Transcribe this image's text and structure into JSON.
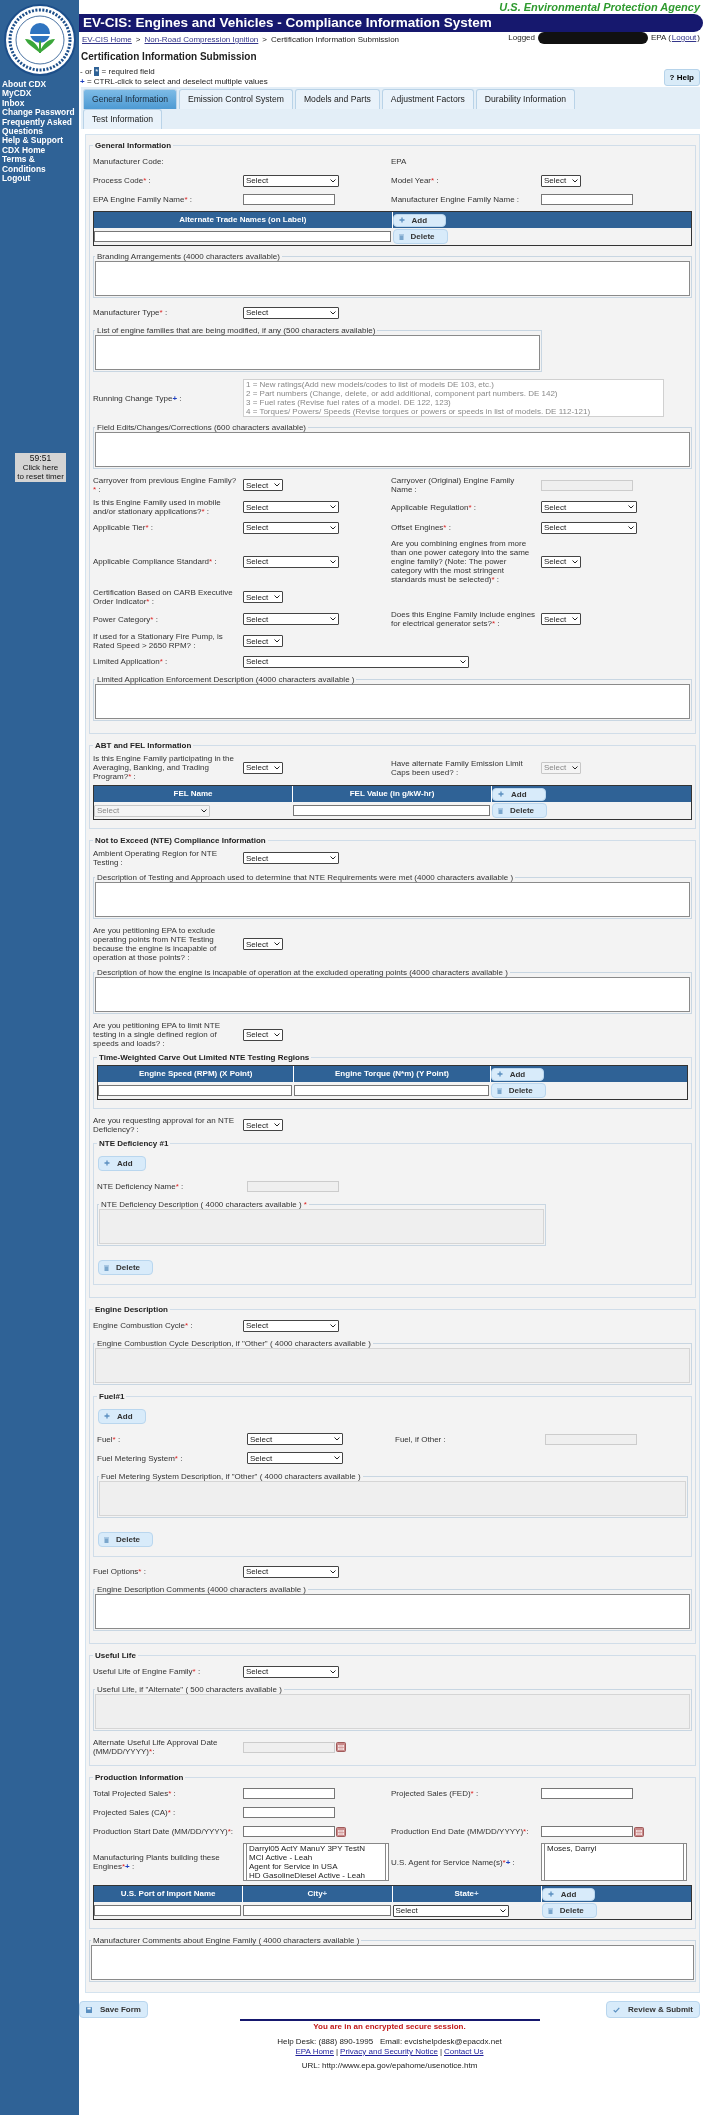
{
  "header": {
    "agency": "U.S. Environmental Protection Agency",
    "title": "EV-CIS: Engines and Vehicles - Compliance Information System",
    "login_start": "Logged",
    "login_end": "EPA (",
    "logout": "Logout",
    "login_close": ")"
  },
  "breadcrumb": [
    {
      "kind": "link",
      "text": "EV-CIS Home"
    },
    {
      "kind": "text",
      "text": ">"
    },
    {
      "kind": "link",
      "text": "Non-Road Compression Ignition"
    },
    {
      "kind": "text",
      "text": ">"
    },
    {
      "kind": "text",
      "text": "Certification Information Submission"
    }
  ],
  "sidebar": {
    "links": [
      "About CDX",
      "MyCDX",
      "Inbox",
      "Change Password",
      "Frequently Asked Questions",
      "Help & Support",
      "CDX Home",
      "Terms & Conditions",
      "Logout"
    ],
    "timer": {
      "time": "59:51",
      "lines": [
        "Click here",
        "to reset timer"
      ]
    }
  },
  "page_title": "Certification Information Submission",
  "legend": [
    {
      "kind": "required",
      "before": "- or",
      "mark": "*",
      "after": "= required field"
    },
    {
      "kind": "multi",
      "mark": "+",
      "after": "= CTRL-click to select and deselect multiple values"
    }
  ],
  "help": "? Help",
  "tabs": [
    {
      "label": "General Information",
      "selected": true
    },
    {
      "label": "Emission Control System",
      "selected": false
    },
    {
      "label": "Models and Parts",
      "selected": false
    },
    {
      "label": "Adjustment Factors",
      "selected": false
    },
    {
      "label": "Durability Information",
      "selected": false
    },
    {
      "label": "Test Information",
      "selected": false
    }
  ],
  "form": [
    {
      "kind": "fieldset",
      "title": "General Information",
      "items": [
        {
          "kind": "row",
          "cells": [
            {
              "kind": "label",
              "text": "Manufacturer Code:"
            },
            {
              "kind": "empty"
            },
            {
              "kind": "static",
              "text": "EPA"
            }
          ]
        },
        {
          "kind": "row",
          "cells": [
            {
              "kind": "label",
              "text": "Process Code",
              "star": "*",
              "colon": " :"
            },
            {
              "kind": "select",
              "value": "Select",
              "disabled": false
            },
            {
              "kind": "label",
              "text": "Model Year",
              "star": "*",
              "colon": " :"
            },
            {
              "kind": "small_select",
              "value": "Select",
              "disabled": false
            }
          ]
        },
        {
          "kind": "row",
          "cells": [
            {
              "kind": "label",
              "text": "EPA Engine Family Name",
              "star": "*",
              "colon": " :"
            },
            {
              "kind": "text",
              "disabled": false
            },
            {
              "kind": "label",
              "text": "Manufacturer Engine Family Name :"
            },
            {
              "kind": "text",
              "disabled": false
            }
          ]
        },
        {
          "kind": "table",
          "columns": [
            {
              "label": "Alternate Trade Names (on Label)"
            }
          ],
          "rows": [
            [
              {
                "kind": "text",
                "disabled": false
              }
            ]
          ],
          "add": "Add",
          "delete": "Delete"
        },
        {
          "kind": "textarea",
          "label": "Branding Arrangements",
          "count": "(4000 characters available)",
          "disabled": false
        },
        {
          "kind": "row",
          "cells": [
            {
              "kind": "label",
              "text": "Manufacturer Type",
              "star": "*",
              "colon": " :"
            },
            {
              "kind": "select",
              "value": "Select",
              "disabled": false
            }
          ]
        },
        {
          "kind": "short_textarea",
          "label": "List of engine families that are being modified, if any",
          "count": "(500 characters available)",
          "disabled": false
        },
        {
          "kind": "row",
          "cells": [
            {
              "kind": "label",
              "text": "Running Change Type",
              "plus": "+",
              "colon": " :"
            },
            {
              "kind": "wide_listbox",
              "disabled": true,
              "options": [
                "1 = New ratings(Add new models/codes to list of models DE 103, etc.)",
                "2 = Part numbers (Change, delete, or add additional, component part numbers. DE 142)",
                "3 = Fuel rates (Revise fuel rates of a model. DE 122, 123)",
                "4 = Torques/ Powers/ Speeds (Revise torques or powers or speeds in list of models. DE 112-121)"
              ]
            }
          ]
        },
        {
          "kind": "textarea",
          "label": "Field Edits/Changes/Corrections",
          "count": "(600 characters available)",
          "disabled": false
        },
        {
          "kind": "row",
          "cells": [
            {
              "kind": "label",
              "text": "Carryover from previous Engine Family?",
              "star": "*",
              "colon": " :"
            },
            {
              "kind": "small_select",
              "value": "Select",
              "disabled": false
            },
            {
              "kind": "label",
              "text": "Carryover (Original) Engine Family Name :"
            },
            {
              "kind": "text",
              "disabled": true
            }
          ]
        },
        {
          "kind": "row",
          "cells": [
            {
              "kind": "label",
              "text": "Is this Engine Family used in mobile and/or stationary applications?",
              "star": "*",
              "colon": " :"
            },
            {
              "kind": "select",
              "value": "Select",
              "disabled": false
            },
            {
              "kind": "label",
              "text": "Applicable Regulation",
              "star": "*",
              "colon": " :"
            },
            {
              "kind": "select",
              "value": "Select",
              "disabled": false
            }
          ]
        },
        {
          "kind": "row",
          "cells": [
            {
              "kind": "label",
              "text": "Applicable Tier",
              "star": "*",
              "colon": " :"
            },
            {
              "kind": "select",
              "value": "Select",
              "disabled": false
            },
            {
              "kind": "label",
              "text": "Offset Engines",
              "star": "*",
              "colon": " :"
            },
            {
              "kind": "select",
              "value": "Select",
              "disabled": false
            }
          ]
        },
        {
          "kind": "row",
          "cells": [
            {
              "kind": "label",
              "text": "Applicable Compliance Standard",
              "star": "*",
              "colon": " :"
            },
            {
              "kind": "select",
              "value": "Select",
              "disabled": false
            },
            {
              "kind": "label",
              "text": "Are you combining engines from more than one power category into the same engine family? (Note: The power category with the most stringent standards must be selected)",
              "star": "*",
              "colon": " :"
            },
            {
              "kind": "small_select",
              "value": "Select",
              "disabled": false
            }
          ]
        },
        {
          "kind": "row",
          "cells": [
            {
              "kind": "label",
              "text": "Certification Based on CARB Executive Order Indicator",
              "star": "*",
              "colon": " :"
            },
            {
              "kind": "small_select",
              "value": "Select",
              "disabled": false
            }
          ]
        },
        {
          "kind": "row",
          "cells": [
            {
              "kind": "label",
              "text": "Power Category",
              "star": "*",
              "colon": " :"
            },
            {
              "kind": "select",
              "value": "Select",
              "disabled": false
            },
            {
              "kind": "label",
              "text": "Does this Engine Family include engines for electrical generator sets?",
              "star": "*",
              "colon": " :"
            },
            {
              "kind": "small_select",
              "value": "Select",
              "disabled": false
            }
          ]
        },
        {
          "kind": "row",
          "cells": [
            {
              "kind": "label",
              "text": "If used for a Stationary Fire Pump, is Rated Speed > 2650 RPM? :"
            },
            {
              "kind": "small_select",
              "value": "Select",
              "disabled": false
            }
          ]
        },
        {
          "kind": "row",
          "cells": [
            {
              "kind": "label",
              "text": "Limited Application",
              "star": "*",
              "colon": " :"
            },
            {
              "kind": "wide_select",
              "value": "Select",
              "disabled": false
            }
          ]
        },
        {
          "kind": "textarea",
          "label": "Limited Application Enforcement Description",
          "count": "(4000 characters available )",
          "disabled": false
        }
      ]
    },
    {
      "kind": "fieldset",
      "title": "ABT and FEL Information",
      "items": [
        {
          "kind": "row",
          "cells": [
            {
              "kind": "label",
              "text": "Is this Engine Family participating in the Averaging, Banking, and Trading Program?",
              "star": "*",
              "colon": " :"
            },
            {
              "kind": "small_select",
              "value": "Select",
              "disabled": false
            },
            {
              "kind": "label",
              "text": "Have alternate Family Emission Limit Caps been used? :"
            },
            {
              "kind": "small_select",
              "value": "Select",
              "disabled": true
            }
          ]
        },
        {
          "kind": "table",
          "columns": [
            {
              "label": "FEL Name"
            },
            {
              "label": "FEL Value (in g/kW-hr)"
            }
          ],
          "rows": [
            [
              {
                "kind": "select",
                "value": "Select",
                "disabled": true
              },
              {
                "kind": "text",
                "disabled": false
              }
            ]
          ],
          "add": "Add",
          "delete": "Delete"
        }
      ]
    },
    {
      "kind": "fieldset",
      "title": "Not to Exceed (NTE) Compliance Information",
      "items": [
        {
          "kind": "row",
          "cells": [
            {
              "kind": "label",
              "text": "Ambient Operating Region for NTE Testing :"
            },
            {
              "kind": "select",
              "value": "Select",
              "disabled": false
            }
          ]
        },
        {
          "kind": "textarea",
          "label": "Description of Testing and Approach used to determine that NTE Requirements were met (4000 characters available )",
          "disabled": false
        },
        {
          "kind": "row",
          "cells": [
            {
              "kind": "label",
              "text": "Are you petitioning EPA to exclude operating points from NTE Testing because the engine is incapable of operation at those points? :"
            },
            {
              "kind": "small_select",
              "value": "Select",
              "disabled": false
            }
          ]
        },
        {
          "kind": "textarea",
          "label": "Description of how the engine is incapable of operation at the excluded operating points (4000 characters available )",
          "disabled": false
        },
        {
          "kind": "row",
          "cells": [
            {
              "kind": "label",
              "text": "Are you petitioning EPA to limit NTE testing in a single defined region of speeds and loads? :"
            },
            {
              "kind": "small_select",
              "value": "Select",
              "disabled": false
            }
          ]
        },
        {
          "kind": "fieldset",
          "title": "Time-Weighted Carve Out Limited NTE Testing Regions",
          "items": [
            {
              "kind": "table",
              "columns": [
                {
                  "label": "Engine Speed (RPM) (X Point)"
                },
                {
                  "label": "Engine Torque (N*m) (Y Point)"
                }
              ],
              "rows": [
                [
                  {
                    "kind": "text",
                    "disabled": false
                  },
                  {
                    "kind": "text",
                    "disabled": false
                  }
                ]
              ],
              "add": "Add",
              "delete": "Delete"
            }
          ]
        },
        {
          "kind": "row",
          "cells": [
            {
              "kind": "label",
              "text": "Are you requesting approval for an NTE Deficiency? :"
            },
            {
              "kind": "small_select",
              "value": "Select",
              "disabled": false
            }
          ]
        },
        {
          "kind": "fieldset",
          "title": "NTE Deficiency #1",
          "items": [
            {
              "kind": "add_button",
              "label": "Add"
            },
            {
              "kind": "row",
              "cells": [
                {
                  "kind": "label",
                  "text": "NTE Deficiency Name",
                  "star": "*",
                  "colon": " :"
                },
                {
                  "kind": "text",
                  "disabled": true
                }
              ]
            },
            {
              "kind": "short_textarea",
              "label": "NTE Deficiency Description",
              "count": "( 4000 characters available )",
              "star": "*",
              "disabled": true
            },
            {
              "kind": "delete_button",
              "label": "Delete"
            }
          ]
        }
      ]
    },
    {
      "kind": "fieldset",
      "title": "Engine Description",
      "items": [
        {
          "kind": "row",
          "cells": [
            {
              "kind": "label",
              "text": "Engine Combustion Cycle",
              "star": "*",
              "colon": " :"
            },
            {
              "kind": "select",
              "value": "Select",
              "disabled": false
            }
          ]
        },
        {
          "kind": "textarea",
          "label": "Engine Combustion Cycle Description, if \"Other\"",
          "count": "( 4000 characters available )",
          "disabled": true
        },
        {
          "kind": "fieldset",
          "title": "Fuel#1",
          "items": [
            {
              "kind": "add_button",
              "label": "Add"
            },
            {
              "kind": "row",
              "cells": [
                {
                  "kind": "label",
                  "text": "Fuel",
                  "star": "*",
                  "colon": " :"
                },
                {
                  "kind": "select",
                  "value": "Select",
                  "disabled": false
                },
                {
                  "kind": "label",
                  "text": "Fuel, if Other :"
                },
                {
                  "kind": "text",
                  "disabled": true
                }
              ]
            },
            {
              "kind": "row",
              "cells": [
                {
                  "kind": "label",
                  "text": "Fuel Metering System",
                  "star": "*",
                  "colon": " :"
                },
                {
                  "kind": "select",
                  "value": "Select",
                  "disabled": false
                }
              ]
            },
            {
              "kind": "textarea",
              "label": "Fuel Metering System Description, if \"Other\"",
              "count": "( 4000 characters available )",
              "disabled": true
            },
            {
              "kind": "delete_button",
              "label": "Delete"
            }
          ]
        },
        {
          "kind": "row",
          "cells": [
            {
              "kind": "label",
              "text": "Fuel Options",
              "star": "*",
              "colon": " :"
            },
            {
              "kind": "select",
              "value": "Select",
              "disabled": false
            }
          ]
        },
        {
          "kind": "textarea",
          "label": "Engine Description Comments (4000 characters available )",
          "disabled": false
        }
      ]
    },
    {
      "kind": "fieldset",
      "title": "Useful Life",
      "items": [
        {
          "kind": "row",
          "cells": [
            {
              "kind": "label",
              "text": "Useful Life of Engine Family",
              "star": "*",
              "colon": " :"
            },
            {
              "kind": "select",
              "value": "Select",
              "disabled": false
            }
          ]
        },
        {
          "kind": "textarea",
          "label": "Useful Life, if \"Alternate\"",
          "count": "( 500 characters available )",
          "disabled": true
        },
        {
          "kind": "row",
          "cells": [
            {
              "kind": "label",
              "text": "Alternate Useful Life Approval Date (MM/DD/YYYY)",
              "star": "*",
              "colon": ":"
            },
            {
              "kind": "date",
              "disabled": true
            }
          ]
        }
      ]
    },
    {
      "kind": "fieldset",
      "title": "Production Information",
      "items": [
        {
          "kind": "row",
          "cells": [
            {
              "kind": "label",
              "text": "Total Projected Sales",
              "star": "*",
              "colon": " :"
            },
            {
              "kind": "text",
              "disabled": false
            },
            {
              "kind": "label",
              "text": "Projected Sales (FED)",
              "star": "*",
              "colon": " :"
            },
            {
              "kind": "text",
              "disabled": false
            }
          ]
        },
        {
          "kind": "row",
          "cells": [
            {
              "kind": "label",
              "text": "Projected Sales (CA)",
              "star": "*",
              "colon": " :"
            },
            {
              "kind": "text",
              "disabled": false
            }
          ]
        },
        {
          "kind": "row",
          "cells": [
            {
              "kind": "label",
              "text": "Production Start Date (MM/DD/YYYY)",
              "star": "*",
              "colon": ":"
            },
            {
              "kind": "date",
              "disabled": false
            },
            {
              "kind": "label",
              "text": "Production End Date (MM/DD/YYYY)",
              "star": "*",
              "colon": ":"
            },
            {
              "kind": "date",
              "disabled": false
            }
          ]
        },
        {
          "kind": "row",
          "cells": [
            {
              "kind": "label",
              "text": "Manufacturing Plants building these Engines",
              "star": "*",
              "plus": "+",
              "colon": " :"
            },
            {
              "kind": "listbox",
              "disabled": false,
              "options": [
                "Darryl05 ActY ManuY 3PY TestN",
                "MCI Active - Leah",
                "Agent for Service in USA",
                "HD GasolineDiesel Active - Leah"
              ]
            },
            {
              "kind": "label",
              "text": "U.S. Agent for Service Name(s)",
              "star": "*",
              "plus": "+",
              "colon": " :"
            },
            {
              "kind": "listbox",
              "disabled": false,
              "options": [
                "Moses, Darryl"
              ]
            }
          ]
        },
        {
          "kind": "table",
          "columns": [
            {
              "label": "U.S. Port of Import Name"
            },
            {
              "label": "City",
              "plus": "+"
            },
            {
              "label": "State",
              "plus": "+"
            }
          ],
          "rows": [
            [
              {
                "kind": "text",
                "disabled": false
              },
              {
                "kind": "text",
                "disabled": false
              },
              {
                "kind": "select",
                "value": "Select",
                "disabled": false
              }
            ]
          ],
          "add": "Add",
          "delete": "Delete"
        }
      ]
    },
    {
      "kind": "textarea",
      "label": "Manufacturer Comments about Engine Family",
      "count": "( 4000 characters available )",
      "disabled": false
    }
  ],
  "actions": [
    {
      "kind": "save",
      "label": "Save Form"
    },
    {
      "kind": "submit",
      "label": "Review & Submit"
    }
  ],
  "footer": {
    "notice": "You are in an encrypted secure session.",
    "helpdesk": "Help Desk: (888) 890-1995   Email: evcishelpdesk@epacdx.net",
    "links": [
      {
        "kind": "link",
        "text": "EPA Home"
      },
      {
        "kind": "sep",
        "text": "|"
      },
      {
        "kind": "link",
        "text": "Privacy and Security Notice"
      },
      {
        "kind": "sep",
        "text": "|"
      },
      {
        "kind": "link",
        "text": "Contact Us"
      }
    ],
    "url": "URL: http://www.epa.gov/epahome/usenotice.htm"
  }
}
